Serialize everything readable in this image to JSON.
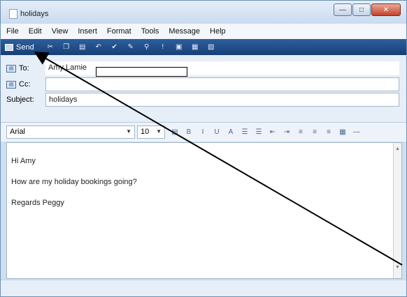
{
  "window": {
    "title": "holidays"
  },
  "menu": [
    "File",
    "Edit",
    "View",
    "Insert",
    "Format",
    "Tools",
    "Message",
    "Help"
  ],
  "toolbar": {
    "send_label": "Send",
    "icons": [
      "cut-icon",
      "copy-icon",
      "paste-icon",
      "undo-icon",
      "check-names-icon",
      "spelling-icon",
      "attach-icon",
      "priority-icon",
      "sign-icon",
      "encrypt-icon",
      "offline-icon"
    ]
  },
  "header": {
    "to_label": "To:",
    "to_value": "Amy Lamie",
    "cc_label": "Cc:",
    "cc_value": "",
    "subject_label": "Subject:",
    "subject_value": "holidays"
  },
  "format": {
    "font": "Arial",
    "size": "10"
  },
  "body": {
    "lines": [
      "Hi Amy",
      "How are my holiday bookings going?",
      "Regards Peggy"
    ]
  },
  "colors": {
    "toolbar": "#1f4a86",
    "window_frame": "#cfdff0",
    "annotation": "#000000"
  }
}
